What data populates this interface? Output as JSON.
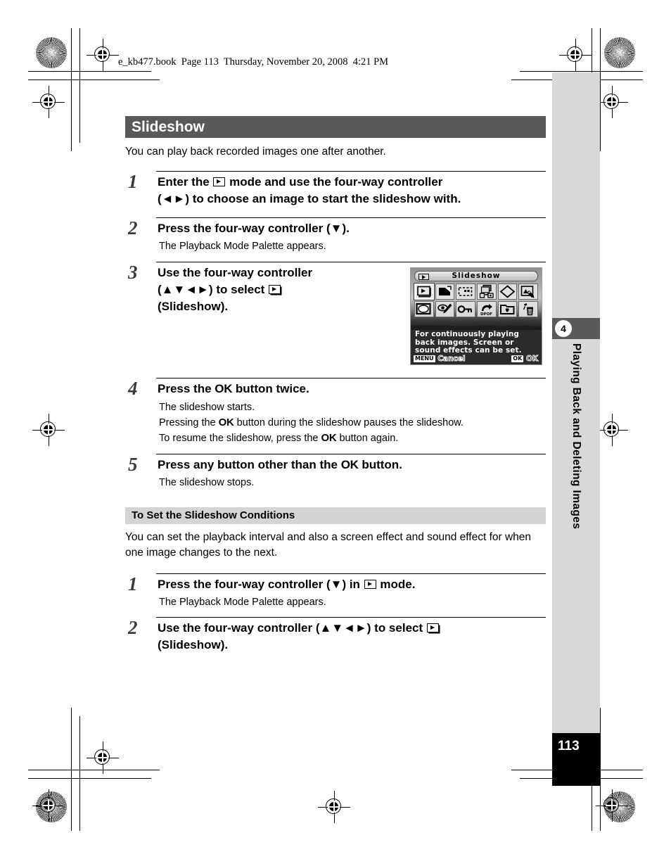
{
  "running_head": "e_kb477.book  Page 113  Thursday, November 20, 2008  4:21 PM",
  "section": {
    "title": "Slideshow",
    "intro": "You can play back recorded images one after another."
  },
  "steps_main": [
    {
      "number": "1",
      "title_parts": [
        "Enter the ",
        "[PLAYBACK]",
        " mode and use the four-way controller (◄►) to choose an image to start the slideshow with."
      ],
      "title_line1_a": "Enter the ",
      "title_line1_b": " mode and use the four-way controller",
      "title_line2": "(◄►) to choose an image to start the slideshow with.",
      "body": ""
    },
    {
      "number": "2",
      "title": "Press the four-way controller (▼).",
      "body": "The Playback Mode Palette appears."
    },
    {
      "number": "3",
      "title_line1": "Use the four-way controller",
      "title_line2_a": "(▲▼◄►) to select ",
      "title_line3": "(Slideshow).",
      "body": ""
    },
    {
      "number": "4",
      "title_a": "Press the ",
      "title_ok": "OK",
      "title_b": " button twice.",
      "body_line1": "The slideshow starts.",
      "body_line2_a": "Pressing the ",
      "body_line2_ok": "OK",
      "body_line2_b": " button during the slideshow pauses the slideshow.",
      "body_line3_a": "To resume the slideshow, press the ",
      "body_line3_ok": "OK",
      "body_line3_b": " button again."
    },
    {
      "number": "5",
      "title_a": "Press any button other than the ",
      "title_ok": "OK",
      "title_b": " button.",
      "body": "The slideshow stops."
    }
  ],
  "subsection": {
    "heading": "To Set the Slideshow Conditions",
    "paragraph": "You can set the playback interval and also a screen effect and sound effect for when one image changes to the next."
  },
  "steps_sub": [
    {
      "number": "1",
      "title_a": "Press the four-way controller (▼) in ",
      "title_b": " mode.",
      "body": "The Playback Mode Palette appears."
    },
    {
      "number": "2",
      "title_a": "Use the four-way controller (▲▼◄►) to select ",
      "title_line2": "(Slideshow).",
      "body": ""
    }
  ],
  "lcd": {
    "title": "Slideshow",
    "title_icon": "playback-icon",
    "icons_row1": [
      "slideshow-icon",
      "image-rotation-icon",
      "resize-icon",
      "image-copy-icon",
      "digital-filter-icon",
      "frame-composite-icon"
    ],
    "icons_row2": [
      "red-eye-oval-icon",
      "red-eye-edit-icon",
      "protect-key-icon",
      "dpof-icon",
      "favorites-folder-icon",
      "delete-trash-icon"
    ],
    "selected_icon": "slideshow-icon",
    "help_line1": "For continuously playing",
    "help_line2": "back images. Screen or",
    "help_line3": "sound effects can be set.",
    "footer_left_tag": "MENU",
    "footer_left_label": "Cancel",
    "footer_right_tag": "OK",
    "footer_right_label": "OK"
  },
  "rail": {
    "chapter_number": "4",
    "chapter_title": "Playing Back and Deleting Images",
    "page_number": "113"
  },
  "colors": {
    "section_header_bg": "#595959",
    "subhead_bg": "#d4d4d4",
    "rail_bg": "#d8d8d8",
    "page_block_bg": "#000000",
    "text": "#000000"
  }
}
